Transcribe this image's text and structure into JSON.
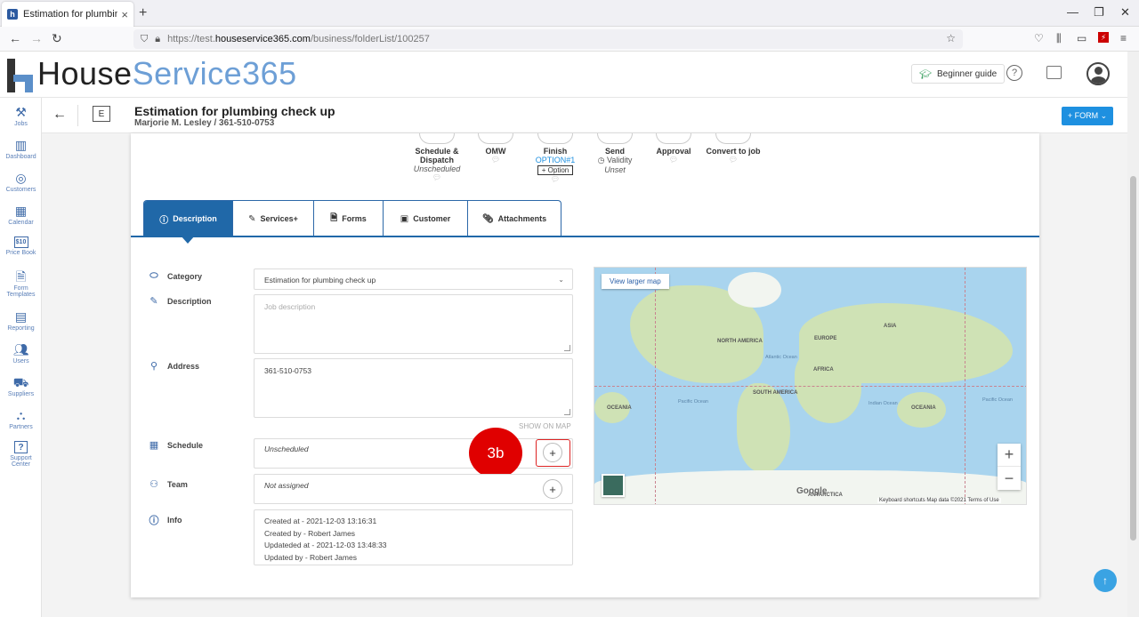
{
  "browser": {
    "tab_title": "Estimation for plumbing check",
    "tab_close": "×",
    "new_tab": "+",
    "url_prefix": "https://test.",
    "url_domain": "houseservice365.com",
    "url_path": "/business/folderList/100257",
    "controls": {
      "minimize": "—",
      "restore": "❐",
      "close": "✕"
    }
  },
  "app": {
    "brand_part1": "House",
    "brand_part2": "Service365",
    "beginner_guide": "Beginner guide",
    "help": "?"
  },
  "sidebar": {
    "items": [
      {
        "label": "Jobs",
        "icon": "tools-icon"
      },
      {
        "label": "Dashboard",
        "icon": "chart-icon"
      },
      {
        "label": "Customers",
        "icon": "target-icon"
      },
      {
        "label": "Calendar",
        "icon": "calendar-icon"
      },
      {
        "label": "Price Book",
        "icon": "price-icon",
        "glyph": "$10"
      },
      {
        "label": "Form Templates",
        "icon": "form-icon"
      },
      {
        "label": "Reporting",
        "icon": "report-icon"
      },
      {
        "label": "Users",
        "icon": "users-icon"
      },
      {
        "label": "Suppliers",
        "icon": "truck-icon"
      },
      {
        "label": "Partners",
        "icon": "partners-icon"
      },
      {
        "label": "Support Center",
        "icon": "help-icon",
        "glyph": "?"
      }
    ]
  },
  "job": {
    "badge": "E",
    "title": "Estimation for plumbing check up",
    "subtitle": "Marjorie M. Lesley / 361-510-0753",
    "form_button": "+ FORM ⌄"
  },
  "steps": [
    {
      "label": "Schedule &",
      "label2": "Dispatch",
      "sub": "Unscheduled"
    },
    {
      "label": "OMW"
    },
    {
      "label": "Finish",
      "opt": "OPTION#1",
      "opt_btn": "+ Option"
    },
    {
      "label": "Send",
      "sub_icon": "clock-icon",
      "sub_plain": "Validity",
      "sub": "Unset"
    },
    {
      "label": "Approval"
    },
    {
      "label": "Convert to job"
    }
  ],
  "tabs": [
    {
      "label": "Description",
      "icon": "info-icon",
      "active": true
    },
    {
      "label": "Services+",
      "icon": "wrench-icon"
    },
    {
      "label": "Forms",
      "icon": "document-icon"
    },
    {
      "label": "Customer",
      "icon": "id-card-icon"
    },
    {
      "label": "Attachments",
      "icon": "paperclip-icon"
    }
  ],
  "form": {
    "category_label": "Category",
    "category_value": "Estimation for plumbing check up",
    "description_label": "Description",
    "description_placeholder": "Job description",
    "address_label": "Address",
    "address_value": "361-510-0753",
    "show_on_map": "SHOW ON MAP",
    "schedule_label": "Schedule",
    "schedule_value": "Unscheduled",
    "team_label": "Team",
    "team_value": "Not assigned",
    "info_label": "Info",
    "info_lines": [
      "Created at - 2021-12-03 13:16:31",
      "Created by - Robert James",
      "Updateded at - 2021-12-03 13:48:33",
      "Updated by - Robert James"
    ]
  },
  "annotation": {
    "label": "3b"
  },
  "map": {
    "view_larger": "View larger map",
    "labels": {
      "north_america": "NORTH AMERICA",
      "europe": "EUROPE",
      "asia": "ASIA",
      "africa": "AFRICA",
      "south_america": "SOUTH AMERICA",
      "oceania_w": "OCEANIA",
      "oceania_e": "OCEANIA",
      "antarctica": "ANTARCTICA",
      "atlantic": "Atlantic Ocean",
      "pacific_w": "Pacific Ocean",
      "pacific_e": "Pacific Ocean",
      "indian": "Indian Ocean"
    },
    "google": "Google",
    "footer": "Keyboard shortcuts     Map data ©2021     Terms of Use"
  }
}
